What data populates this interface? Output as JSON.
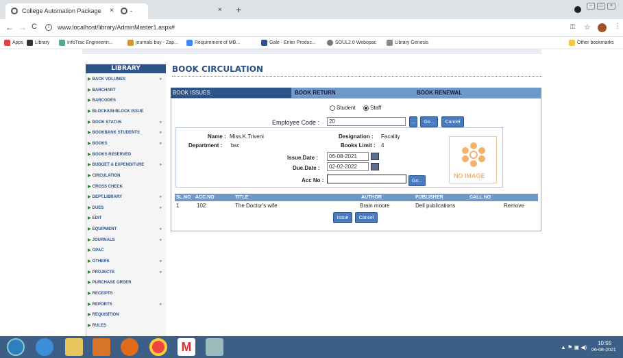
{
  "browser": {
    "tab_title": "College Automation Package",
    "tab2_title": "-",
    "url": "www.localhost/library/AdminMaster1.aspx#",
    "bookmarks": [
      "Apps",
      "Library",
      "InfoTrac Engineerin...",
      "journals buy - Zap...",
      "Requirement of MB...",
      "Gale - Enter Produc...",
      "SOUL2.0 Webopac",
      "Library Genesis"
    ],
    "other_bookmarks": "Other bookmarks"
  },
  "sidebar": {
    "title": "LIBRARY",
    "items": [
      {
        "label": "BACK VOLUMES",
        "chev": "»"
      },
      {
        "label": "BARCHART",
        "chev": ""
      },
      {
        "label": "BARCODES",
        "chev": ""
      },
      {
        "label": "BLOCK/UN-BLOCK ISSUE",
        "chev": ""
      },
      {
        "label": "BOOK STATUS",
        "chev": "»"
      },
      {
        "label": "BOOKBANK STUDENTS",
        "chev": "»"
      },
      {
        "label": "BOOKS",
        "chev": "»"
      },
      {
        "label": "BOOKS RESERVED",
        "chev": ""
      },
      {
        "label": "BUDGET & EXPENDITURE",
        "chev": "»"
      },
      {
        "label": "CIRCULATION",
        "chev": ""
      },
      {
        "label": "CROSS CHECK",
        "chev": ""
      },
      {
        "label": "DEPT.LIBRARY",
        "chev": "»"
      },
      {
        "label": "DUES",
        "chev": "»"
      },
      {
        "label": "EDIT",
        "chev": ""
      },
      {
        "label": "EQUIPMENT",
        "chev": "»"
      },
      {
        "label": "JOURNALS",
        "chev": "»"
      },
      {
        "label": "OPAC",
        "chev": ""
      },
      {
        "label": "OTHERS",
        "chev": "»"
      },
      {
        "label": "PROJECTS",
        "chev": "»"
      },
      {
        "label": "PURCHASE ORDER",
        "chev": ""
      },
      {
        "label": "RECEIPTS",
        "chev": ""
      },
      {
        "label": "REPORTS",
        "chev": "»"
      },
      {
        "label": "REQUISITION",
        "chev": ""
      },
      {
        "label": "RULES",
        "chev": ""
      }
    ]
  },
  "main": {
    "title": "BOOK CIRCULATION",
    "tabs": [
      "BOOK ISSUES",
      "BOOK RETURN",
      "BOOK RENEWAL"
    ],
    "radio_student": "Student",
    "radio_staff": "Staff",
    "employee_code_label": "Employee Code :",
    "employee_code_value": "20",
    "dots_btn": "...",
    "go_btn": "Go...",
    "cancel_btn": "Cancel",
    "name_label": "Name :",
    "name_value": "Miss.K.Triveni",
    "designation_label": "Designation :",
    "designation_value": "Facality",
    "department_label": "Department :",
    "department_value": "bsc",
    "books_limit_label": "Books Limit :",
    "books_limit_value": "4",
    "issue_date_label": "Issue.Date :",
    "issue_date_value": "06-08-2021",
    "due_date_label": "Due.Date :",
    "due_date_value": "02-02-2022",
    "acc_no_label": "Acc No :",
    "acc_go_btn": "Go...",
    "no_image": "NO IMAGE",
    "table_headers": [
      "SL.NO",
      "ACC.NO",
      "TITLE",
      "AUTHOR",
      "PUBLISHER",
      "CALL.NO"
    ],
    "rows": [
      {
        "sl": "1",
        "acc": "102",
        "title": "The Doctor's wife",
        "author": "Brain moore",
        "publisher": "Dell publications",
        "call": "",
        "action": "Remove"
      }
    ],
    "issue_btn": "Issue",
    "cancel2_btn": "Cancel"
  },
  "taskbar": {
    "time": "10:55",
    "date": "06-08-2021"
  },
  "colors": {
    "accent": "#2d5287",
    "tab": "#6d98c8",
    "taskbar": "#3b5f86"
  }
}
